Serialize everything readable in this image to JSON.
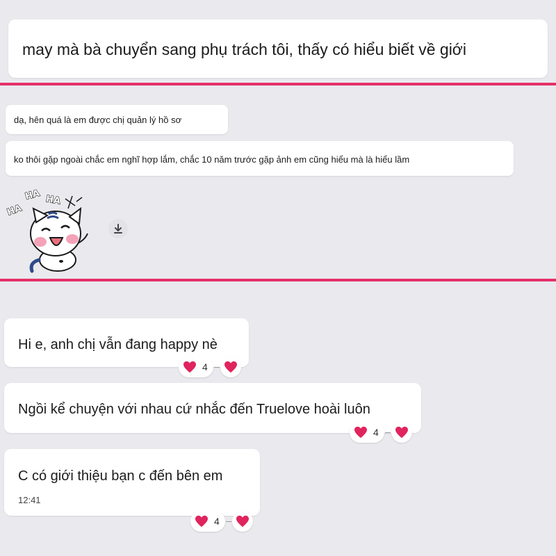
{
  "section1": {
    "message": "may mà bà chuyển sang phụ trách tôi, thấy có hiểu biết về giới"
  },
  "section2": {
    "messages": [
      "dạ, hên quá là em được chị quản lý hồ sơ",
      "ko thôi gặp ngoài chắc em nghĩ hợp lắm, chắc 10 năm trước gặp ảnh em cũng hiểu mà là hiểu lầm"
    ],
    "sticker_text": "HA HA HA",
    "download_icon": "download-icon"
  },
  "section3": {
    "messages": [
      {
        "text": "Hi e, anh chị vẫn đang happy nè",
        "reaction_count": "4"
      },
      {
        "text": "Ngồi kể chuyện với nhau cứ nhắc đến Truelove hoài luôn",
        "reaction_count": "4"
      },
      {
        "text": "C có giới thiệu bạn c đến bên em",
        "time": "12:41",
        "reaction_count": "4"
      }
    ]
  },
  "colors": {
    "divider": "#e53168",
    "background": "#e9e9ee",
    "bubble": "#ffffff",
    "heart": "#e0245e"
  }
}
